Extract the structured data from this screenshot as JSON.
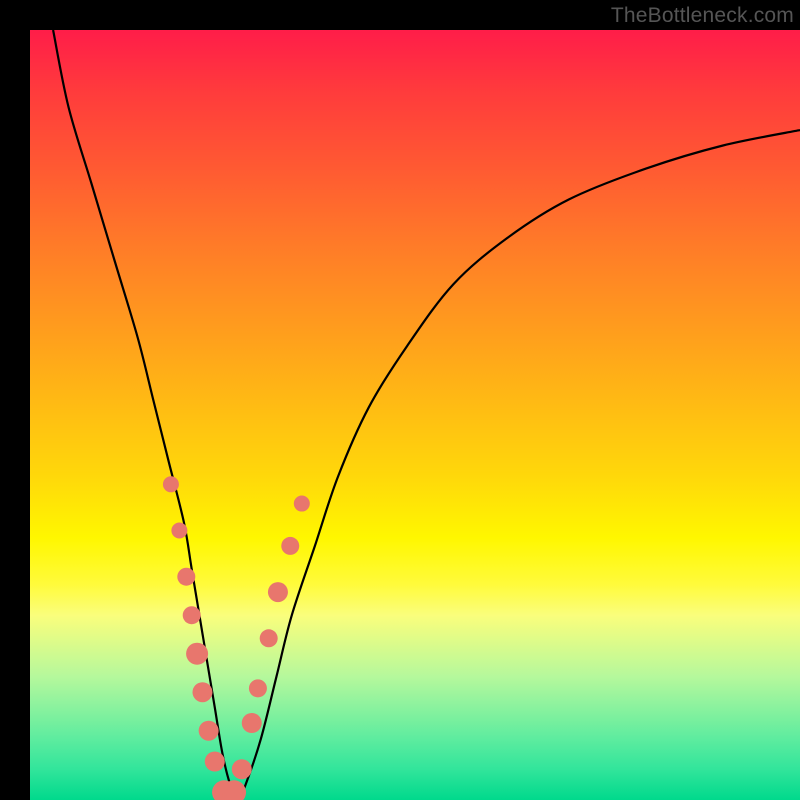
{
  "watermark": "TheBottleneck.com",
  "chart_data": {
    "type": "line",
    "title": "",
    "xlabel": "",
    "ylabel": "",
    "xlim": [
      0,
      100
    ],
    "ylim": [
      0,
      100
    ],
    "series": [
      {
        "name": "bottleneck-curve",
        "x": [
          3,
          5,
          8,
          11,
          14,
          16,
          18,
          20,
          21,
          22,
          23,
          24,
          25,
          26,
          27,
          28,
          30,
          32,
          34,
          37,
          40,
          44,
          49,
          55,
          62,
          70,
          80,
          90,
          100
        ],
        "y": [
          100,
          90,
          80,
          70,
          60,
          52,
          44,
          36,
          30,
          24,
          18,
          12,
          6,
          2,
          0,
          2,
          8,
          16,
          24,
          33,
          42,
          51,
          59,
          67,
          73,
          78,
          82,
          85,
          87
        ]
      }
    ],
    "markers": {
      "name": "highlight-points",
      "x": [
        18.3,
        19.4,
        20.3,
        21.0,
        21.7,
        22.4,
        23.2,
        24.0,
        25.2,
        26.5,
        27.5,
        28.8,
        29.6,
        31.0,
        32.2,
        33.8,
        35.3
      ],
      "y": [
        41.0,
        35.0,
        29.0,
        24.0,
        19.0,
        14.0,
        9.0,
        5.0,
        1.0,
        1.0,
        4.0,
        10.0,
        14.5,
        21.0,
        27.0,
        33.0,
        38.5
      ],
      "size": [
        8,
        8,
        9,
        9,
        11,
        10,
        10,
        10,
        12,
        12,
        10,
        10,
        9,
        9,
        10,
        9,
        8
      ]
    },
    "gradient_stops": [
      {
        "pos": 0,
        "color": "#ff1d49"
      },
      {
        "pos": 50,
        "color": "#ffc400"
      },
      {
        "pos": 70,
        "color": "#fff700"
      },
      {
        "pos": 100,
        "color": "#00d98c"
      }
    ]
  }
}
